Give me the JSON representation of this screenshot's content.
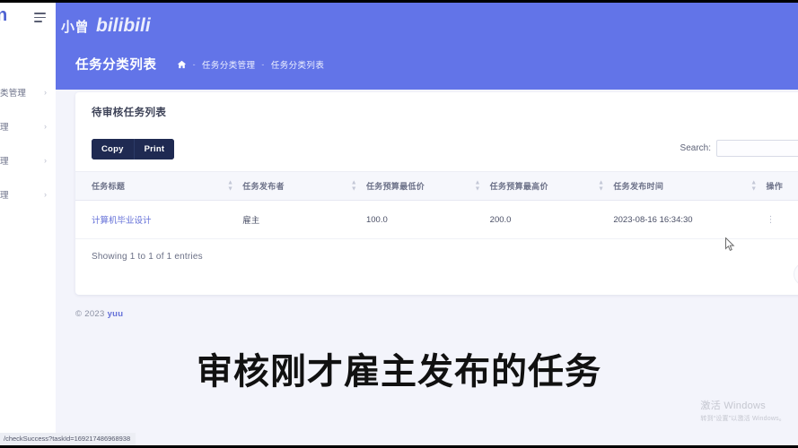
{
  "browser": {
    "logo_fragment": "n",
    "menu_icon": "hamburger-icon"
  },
  "sidebar": {
    "items": [
      {
        "label": "类管理",
        "chevron": "›"
      },
      {
        "label": "理",
        "chevron": "›"
      },
      {
        "label": "理",
        "chevron": "›"
      },
      {
        "label": "理",
        "chevron": "›"
      }
    ]
  },
  "watermark": {
    "channel_text": "小曾",
    "logo": "bilibili"
  },
  "header": {
    "title": "任务分类列表",
    "breadcrumb": {
      "home_icon": "home-icon",
      "items": [
        "任务分类管理",
        "任务分类列表"
      ],
      "separator": "-"
    },
    "accent_color": "#6274e8"
  },
  "card": {
    "title": "待审核任务列表",
    "toolbar": {
      "copy_label": "Copy",
      "print_label": "Print"
    },
    "search": {
      "label": "Search:",
      "value": "",
      "placeholder": ""
    },
    "table": {
      "columns": [
        "任务标题",
        "任务发布者",
        "任务预算最低价",
        "任务预算最高价",
        "任务发布时间",
        "操作"
      ],
      "sort_icon": "sort-arrows-icon",
      "rows": [
        {
          "title": "计算机毕业设计",
          "publisher": "雇主",
          "min_price": "100.0",
          "max_price": "200.0",
          "publish_time": "2023-08-16 16:34:30",
          "action_icon": "kebab-menu-icon"
        }
      ]
    },
    "entries_info": "Showing 1 to 1 of 1 entries",
    "pagination": {
      "prev_label": "‹"
    }
  },
  "footer": {
    "copyright": "© 2023",
    "brand": "yuu"
  },
  "caption": "审核刚才雇主发布的任务",
  "windows_watermark": {
    "line1": "激活 Windows",
    "line2": "转到“设置”以激活 Windows。"
  },
  "status_url": "/checkSuccess?taskId=169217486968938"
}
